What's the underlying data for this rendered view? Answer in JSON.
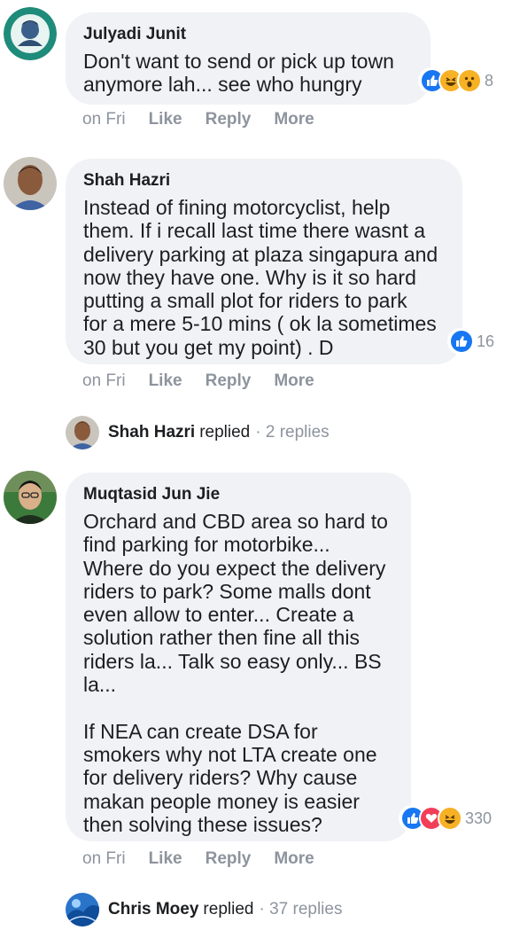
{
  "comments": [
    {
      "author": "Julyadi Junit",
      "text": "Don't want to send or pick up town\nanymore lah... see who hungry",
      "reaction_count": "8",
      "time": "on Fri",
      "like": "Like",
      "reply": "Reply",
      "more": "More"
    },
    {
      "author": "Shah Hazri",
      "text": "Instead of fining motorcyclist, help\nthem. If i recall last time there wasnt a\ndelivery parking at plaza singapura and\nnow they have one. Why is it so hard\nputting a small plot for riders to park\nfor a mere 5-10 mins ( ok la sometimes\n30 but you get my point) . D",
      "reaction_count": "16",
      "time": "on Fri",
      "like": "Like",
      "reply": "Reply",
      "more": "More",
      "replies": {
        "name": "Shah Hazri",
        "verb": "replied",
        "count": "· 2 replies"
      }
    },
    {
      "author": "Muqtasid Jun Jie",
      "text": "Orchard and CBD area so hard to\nfind parking for motorbike...\nWhere do you expect the delivery\nriders to park? Some malls dont\neven allow to enter... Create a\nsolution rather then fine all this\nriders la... Talk so easy only... BS\nla...\n\nIf NEA can create DSA for\nsmokers why not LTA create one\nfor delivery riders? Why cause\nmakan people money is easier\nthen solving these issues?",
      "reaction_count": "330",
      "time": "on Fri",
      "like": "Like",
      "reply": "Reply",
      "more": "More",
      "replies": {
        "name": "Chris Moey",
        "verb": "replied",
        "count": "· 37 replies"
      }
    }
  ],
  "colors": {
    "like_blue": "#1877f2",
    "love_red": "#f33e58",
    "haha_yellow": "#f7b125",
    "bubble_gray": "#f0f2f5",
    "meta_gray": "#8d949e"
  },
  "icons": [
    "like-icon",
    "haha-icon",
    "wow-icon",
    "love-icon"
  ]
}
